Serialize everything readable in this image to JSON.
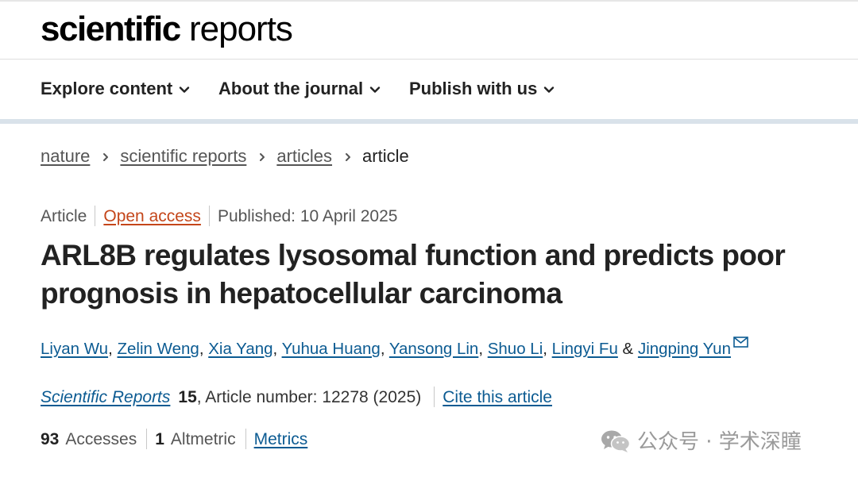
{
  "logo": {
    "bold": "scientific",
    "light": " reports"
  },
  "nav": [
    {
      "label": "Explore content",
      "icon": "chevron-down-icon"
    },
    {
      "label": "About the journal",
      "icon": "chevron-down-icon"
    },
    {
      "label": "Publish with us",
      "icon": "chevron-down-icon"
    }
  ],
  "breadcrumb": {
    "items": [
      "nature",
      "scientific reports",
      "articles"
    ],
    "current": "article",
    "separator_icon": "chevron-right-icon"
  },
  "meta": {
    "type": "Article",
    "access": "Open access",
    "published": "Published: 10 April 2025"
  },
  "title": "ARL8B regulates lysosomal function and predicts poor prognosis in hepatocellular carcinoma",
  "authors": {
    "list": [
      "Liyan Wu",
      "Zelin Weng",
      "Xia Yang",
      "Yuhua Huang",
      "Yansong Lin",
      "Shuo Li",
      "Lingyi Fu"
    ],
    "separator": ", ",
    "conjunction": " & ",
    "last": "Jingping Yun",
    "last_icon": "mail-icon"
  },
  "citation": {
    "journal": "Scientific Reports",
    "volume": "15",
    "details": ", Article number: 12278 (2025)",
    "cite_link": "Cite this article"
  },
  "metrics": {
    "accesses_count": "93",
    "accesses_label": "Accesses",
    "altmetric_count": "1",
    "altmetric_label": "Altmetric",
    "metrics_link": "Metrics"
  },
  "watermark": {
    "text": "公众号 · 学术深瞳",
    "icon": "wechat-icon"
  },
  "colors": {
    "link": "#0c5b92",
    "open_access": "#c4461a",
    "nav_divider": "#d9e2ea",
    "watermark": "#9a9a9a"
  }
}
